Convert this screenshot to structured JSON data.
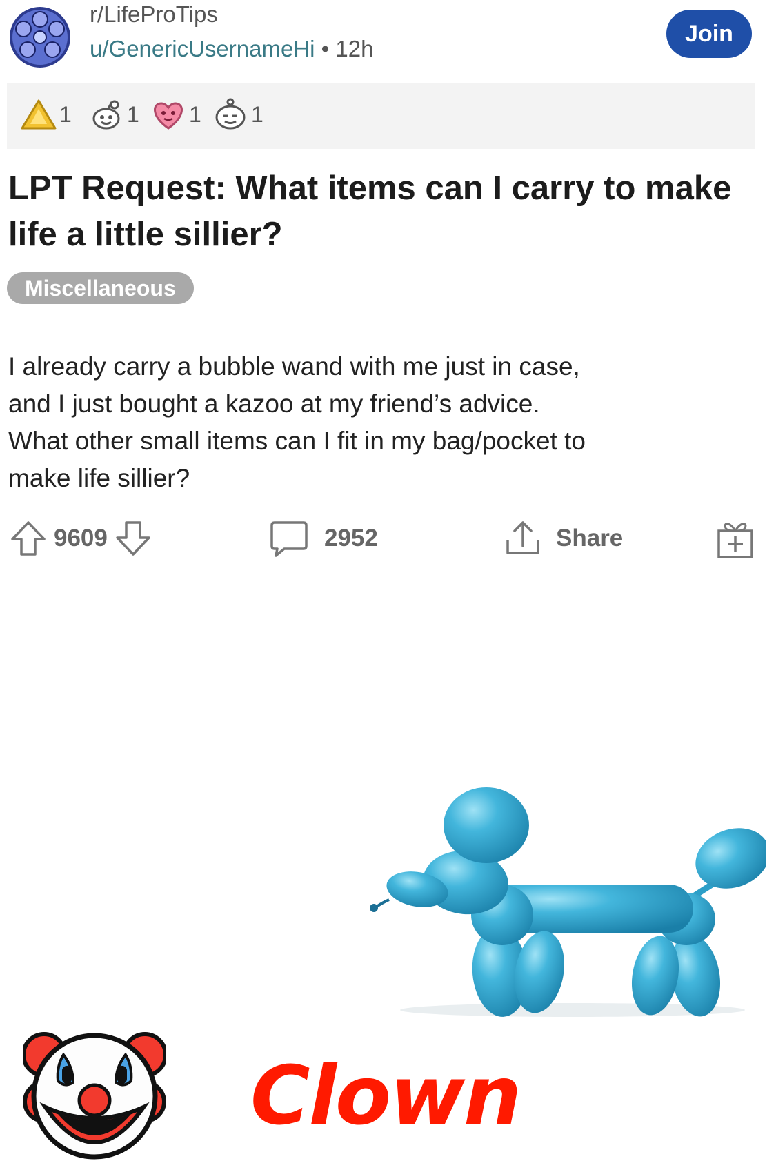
{
  "header": {
    "subreddit": "r/LifeProTips",
    "username": "u/GenericUsernameHi",
    "separator": " • ",
    "age": "12h",
    "join_label": "Join"
  },
  "awards": [
    {
      "icon": "gold-triangle-award-icon",
      "count": "1"
    },
    {
      "icon": "snoo-award-icon",
      "count": "1"
    },
    {
      "icon": "heart-eyes-award-icon",
      "count": "1"
    },
    {
      "icon": "snoo-face-award-icon",
      "count": "1"
    }
  ],
  "post": {
    "title": "LPT Request: What items can I carry to make life a little sillier?",
    "flair": "Miscellaneous",
    "body_lines": [
      "I already carry a bubble wand with me just in case,",
      "and I just bought a kazoo at my friend’s advice.",
      "What other small items can I fit in my bag/pocket to",
      "make life sillier?"
    ]
  },
  "actions": {
    "upvotes": "9609",
    "comments": "2952",
    "share_label": "Share"
  },
  "meme": {
    "caption": "Clown",
    "caption_color": "#ff1a00",
    "balloon_color": "#2fa6cf"
  },
  "colors": {
    "join_button": "#1f4fa8",
    "flair_bg": "#a9a9a9",
    "username": "#3a7a86"
  }
}
